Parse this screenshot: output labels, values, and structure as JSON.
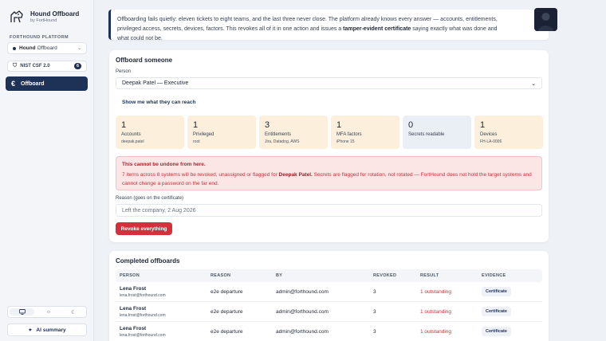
{
  "sidebar": {
    "brand_title": "Hound Offboard",
    "brand_sub": "by FortHound",
    "section_label": "FORTHOUND PLATFORM",
    "workspace_bold": "Hound",
    "workspace_rest": "Offboard",
    "nist_label": "NIST CSF 2.0",
    "nist_count": "6",
    "nav_offboard": "Offboard",
    "ai_summary": "AI summary"
  },
  "intro": {
    "text_a": "Offboarding fails quietly: eleven tickets to eight teams, and the last three never close. The platform already knows every answer — accounts, entitlements, privileged access, secrets, devices, factors. This revokes all of it in one action and issues a ",
    "text_bold": "tamper-evident certificate",
    "text_b": " saying exactly what was done and what could not be."
  },
  "offboard": {
    "title": "Offboard someone",
    "person_label": "Person",
    "person_value": "Deepak Patel — Executive",
    "reach_link": "Show me what they can reach",
    "stats": [
      {
        "num": "1",
        "label": "Accounts",
        "sub": "deepak.patel"
      },
      {
        "num": "1",
        "label": "Privileged",
        "sub": "root"
      },
      {
        "num": "3",
        "label": "Entitlements",
        "sub": "Jira, Datadog, AWS"
      },
      {
        "num": "1",
        "label": "MFA factors",
        "sub": "iPhone 15"
      },
      {
        "num": "0",
        "label": "Secrets readable",
        "sub": ""
      },
      {
        "num": "1",
        "label": "Devices",
        "sub": "FH-LA-0006"
      }
    ],
    "alert_title": "This cannot be undone from here.",
    "alert_a": "7 items across 8 systems will be revoked, unassigned or flagged for ",
    "alert_name": "Deepak Patel.",
    "alert_b": " Secrets are flagged for rotation, not rotated — FortHound does not hold the target systems and cannot change a password on the far end.",
    "reason_label": "Reason (goes on the certificate)",
    "reason_placeholder": "Left the company, 2 Aug 2026",
    "revoke_label": "Revoke everything"
  },
  "completed": {
    "title": "Completed offboards",
    "columns": [
      "Person",
      "Reason",
      "By",
      "Revoked",
      "Result",
      "Evidence"
    ],
    "rows": [
      {
        "name": "Lena Frost",
        "email": "lena.frost@forthound.com",
        "reason": "e2e departure",
        "by": "admin@forthound.com",
        "revoked": "3",
        "result": "1 outstanding",
        "evidence": "Certificate"
      },
      {
        "name": "Lena Frost",
        "email": "lena.frost@forthound.com",
        "reason": "e2e departure",
        "by": "admin@forthound.com",
        "revoked": "3",
        "result": "1 outstanding",
        "evidence": "Certificate"
      },
      {
        "name": "Lena Frost",
        "email": "lena.frost@forthound.com",
        "reason": "e2e departure",
        "by": "admin@forthound.com",
        "revoked": "3",
        "result": "1 outstanding",
        "evidence": "Certificate"
      }
    ]
  },
  "colors": {
    "accent": "#1e3157",
    "danger": "#d42f3b",
    "warm_tile": "#fcefdc"
  }
}
